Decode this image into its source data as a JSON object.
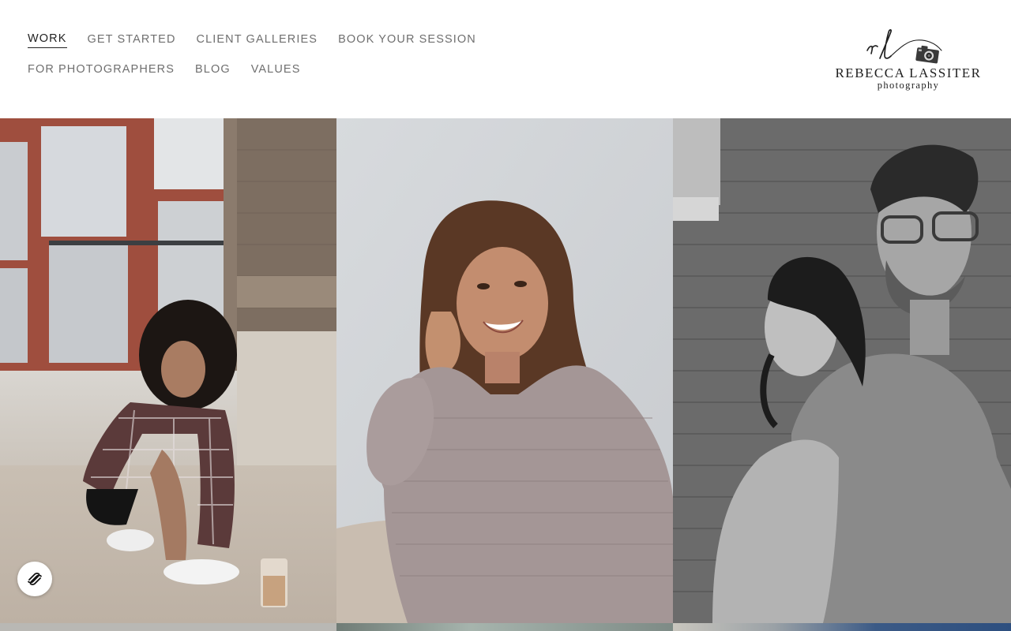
{
  "nav": {
    "row1": [
      {
        "label": "WORK",
        "active": true
      },
      {
        "label": "GET STARTED",
        "active": false
      },
      {
        "label": "CLIENT GALLERIES",
        "active": false
      },
      {
        "label": "BOOK YOUR SESSION",
        "active": false
      }
    ],
    "row2": [
      {
        "label": "FOR PHOTOGRAPHERS",
        "active": false
      },
      {
        "label": "BLOG",
        "active": false
      },
      {
        "label": "VALUES",
        "active": false
      }
    ]
  },
  "logo": {
    "monogram": "rl",
    "name": "REBECCA LASSITER",
    "subtitle": "photography"
  },
  "colors": {
    "nav_text": "#6f6f6f",
    "nav_active": "#222222",
    "logo_text": "#1f1f1f",
    "background": "#ffffff"
  },
  "icons": {
    "badge": "squarespace-logo-icon",
    "logo_camera": "camera-icon"
  }
}
